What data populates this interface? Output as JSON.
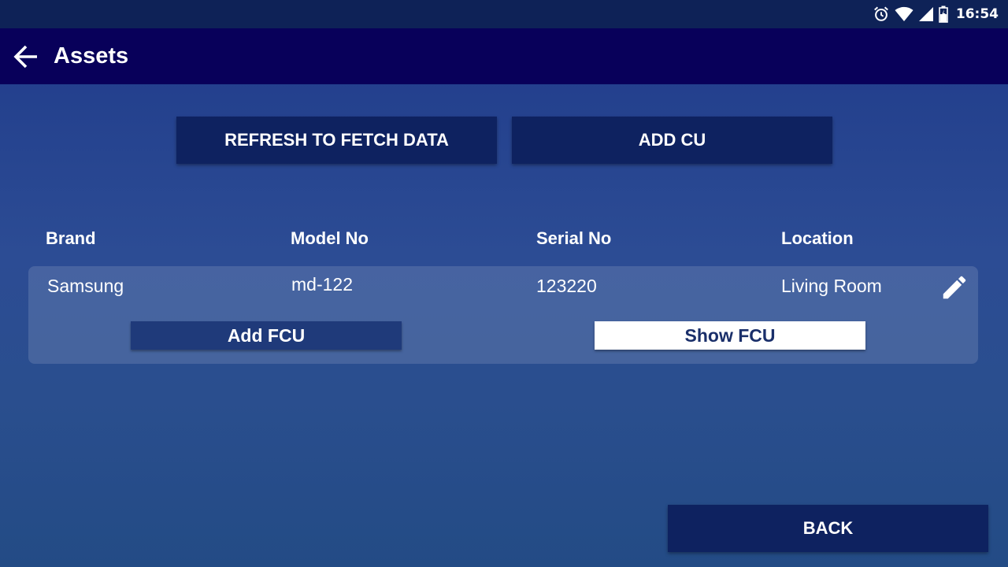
{
  "status_bar": {
    "time": "16:54",
    "icons": [
      "alarm-icon",
      "wifi-icon",
      "signal-icon",
      "battery-icon"
    ]
  },
  "app_bar": {
    "title": "Assets",
    "back_icon": "arrow-left-icon"
  },
  "actions": {
    "refresh_label": "REFRESH TO FETCH DATA",
    "add_cu_label": "ADD CU",
    "back_label": "BACK"
  },
  "table": {
    "columns": [
      "Brand",
      "Model No",
      "Serial No",
      "Location"
    ],
    "rows": [
      {
        "brand": "Samsung",
        "model_no": "md-122",
        "serial_no": "123220",
        "location": "Living Room",
        "edit_icon": "pencil-icon",
        "add_fcu_label": "Add FCU",
        "show_fcu_label": "Show FCU"
      }
    ]
  },
  "colors": {
    "status_bar": "#0e2257",
    "app_bar": "#08005a",
    "button_dark": "#0e2260",
    "add_fcu_button": "#1f3a7a",
    "show_fcu_button": "#ffffff",
    "show_fcu_text": "#1a2f6a"
  }
}
